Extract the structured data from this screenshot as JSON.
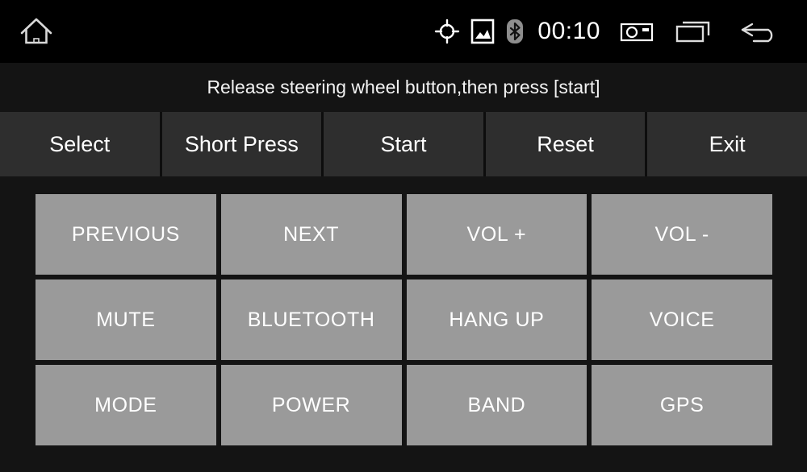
{
  "statusbar": {
    "home_label": "home-icon",
    "clock": "00:10",
    "icons": [
      {
        "name": "gps-icon",
        "label": "GPS"
      },
      {
        "name": "image-icon",
        "label": "Gallery"
      },
      {
        "name": "bluetooth-icon",
        "label": "Bluetooth"
      },
      {
        "name": "camera-icon",
        "label": "Screenshot"
      },
      {
        "name": "recents-icon",
        "label": "Recent apps"
      },
      {
        "name": "back-icon",
        "label": "Back"
      }
    ]
  },
  "hint": {
    "text": "Release steering wheel button,then press [start]"
  },
  "toolbar": {
    "buttons": [
      {
        "label": "Select"
      },
      {
        "label": "Short Press"
      },
      {
        "label": "Start"
      },
      {
        "label": "Reset"
      },
      {
        "label": "Exit"
      }
    ]
  },
  "keygrid": {
    "keys": [
      {
        "label": "PREVIOUS"
      },
      {
        "label": "NEXT"
      },
      {
        "label": "VOL +"
      },
      {
        "label": "VOL -"
      },
      {
        "label": "MUTE"
      },
      {
        "label": "BLUETOOTH"
      },
      {
        "label": "HANG UP"
      },
      {
        "label": "VOICE"
      },
      {
        "label": "MODE"
      },
      {
        "label": "POWER"
      },
      {
        "label": "BAND"
      },
      {
        "label": "GPS"
      }
    ]
  },
  "colors": {
    "statusbar_bg": "#000000",
    "page_bg": "#141414",
    "toolbar_button_bg": "#2e2e2e",
    "key_bg": "#9a9a9a",
    "text": "#ffffff"
  }
}
